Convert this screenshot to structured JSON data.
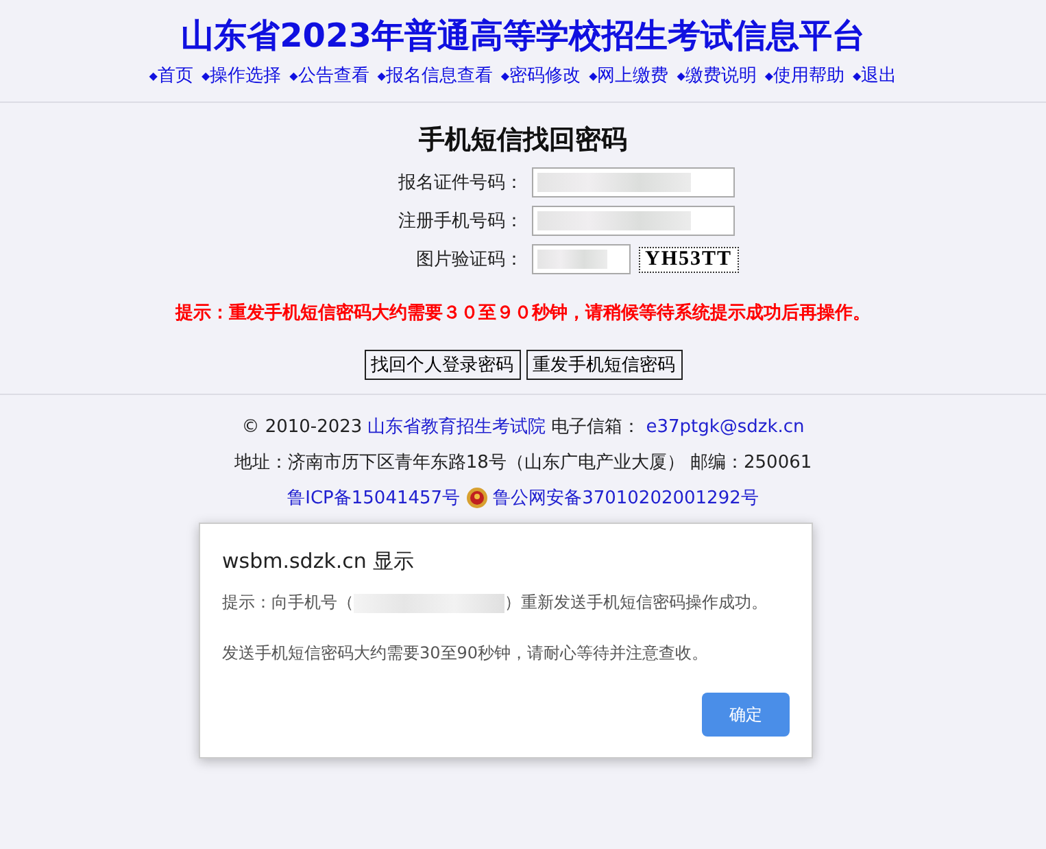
{
  "header": {
    "title": "山东省2023年普通高等学校招生考试信息平台",
    "nav": [
      {
        "bullet": "◆",
        "label": "首页"
      },
      {
        "bullet": "◆",
        "label": "操作选择"
      },
      {
        "bullet": "◆",
        "label": "公告查看"
      },
      {
        "bullet": "◆",
        "label": "报名信息查看"
      },
      {
        "bullet": "◆",
        "label": "密码修改"
      },
      {
        "bullet": "◆",
        "label": "网上缴费"
      },
      {
        "bullet": "◆",
        "label": "缴费说明"
      },
      {
        "bullet": "◆",
        "label": "使用帮助"
      },
      {
        "bullet": "◆",
        "label": "退出"
      }
    ]
  },
  "form": {
    "title": "手机短信找回密码",
    "fields": [
      {
        "label": "报名证件号码：",
        "kind": "wide"
      },
      {
        "label": "注册手机号码：",
        "kind": "wide"
      },
      {
        "label": "图片验证码：",
        "kind": "captcha",
        "captcha": "YH53TT"
      }
    ],
    "hint": "提示：重发手机短信密码大约需要３０至９０秒钟，请稍候等待系统提示成功后再操作。",
    "buttons": [
      "找回个人登录密码",
      "重发手机短信密码"
    ]
  },
  "footer": {
    "copyright": "© 2010-2023",
    "org": "山东省教育招生考试院",
    "email_label": "电子信箱：",
    "email": "e37ptgk@sdzk.cn",
    "address": "地址：济南市历下区青年东路18号（山东广电产业大厦） 邮编：250061",
    "icp": "鲁ICP备15041457号",
    "police": "鲁公网安备37010202001292号"
  },
  "dialog": {
    "title": "wsbm.sdzk.cn 显示",
    "message_before": "提示：向手机号（",
    "message_after": "）重新发送手机短信密码操作成功。",
    "note": "发送手机短信密码大约需要30至90秒钟，请耐心等待并注意查收。",
    "button": "确定"
  }
}
